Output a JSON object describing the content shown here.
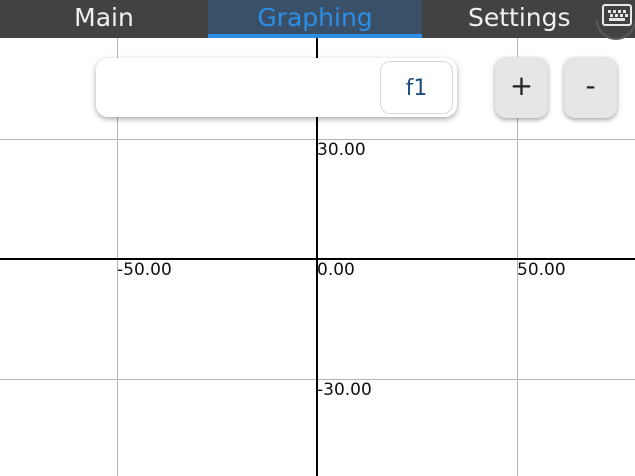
{
  "tabs": [
    {
      "label": "Main"
    },
    {
      "label": "Graphing"
    },
    {
      "label": "Settings"
    }
  ],
  "active_tab": "Graphing",
  "keyboard_icon": "keyboard-icon",
  "function_input": {
    "value": "",
    "placeholder": "",
    "label": "f1"
  },
  "zoom": {
    "in_label": "+",
    "out_label": "-"
  },
  "graph": {
    "x_ticks": [
      "-50.00",
      "0.00",
      "50.00"
    ],
    "y_ticks": [
      "30.00",
      "-30.00"
    ],
    "grid_color": "#b4b4b4",
    "axis_color": "#000000"
  },
  "colors": {
    "topbar": "#424242",
    "accent": "#2d8ee6"
  }
}
